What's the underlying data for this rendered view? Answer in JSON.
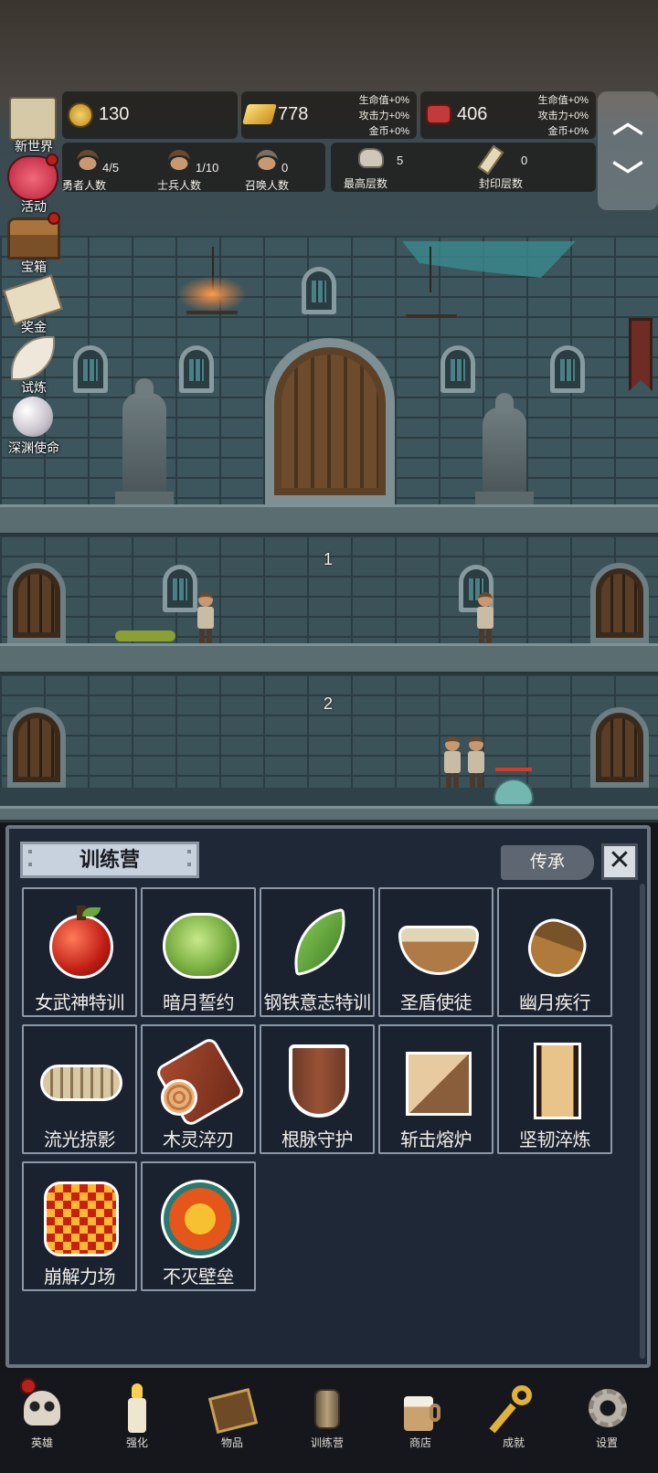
{
  "resources": {
    "gold": "130",
    "gold_bars": "778",
    "gold_bars_bonus": [
      "生命值+0%",
      "攻击力+0%",
      "金币+0%"
    ],
    "meat": "406",
    "meat_bonus": [
      "生命值+0%",
      "攻击力+0%",
      "金币+0%"
    ]
  },
  "stats": {
    "heroes": {
      "value": "4/5",
      "label": "勇者人数"
    },
    "soldiers": {
      "value": "1/10",
      "label": "士兵人数"
    },
    "summons": {
      "value": "0",
      "label": "召唤人数"
    },
    "max_floor": {
      "value": "5",
      "label": "最高层数"
    },
    "sealed_floor": {
      "value": "0",
      "label": "封印层数"
    }
  },
  "side_menu": [
    {
      "label": "新世界",
      "badge": false
    },
    {
      "label": "活动",
      "badge": true
    },
    {
      "label": "宝箱",
      "badge": true
    },
    {
      "label": "奖金",
      "badge": false
    },
    {
      "label": "试炼",
      "badge": false
    },
    {
      "label": "深渊使命",
      "badge": false
    }
  ],
  "floors": [
    "1",
    "2"
  ],
  "panel": {
    "title": "训练营",
    "inherit_label": "传承",
    "close_label": "✕",
    "items": [
      {
        "name": "女武神特训",
        "icon": "apple-icon"
      },
      {
        "name": "暗月誓约",
        "icon": "cabbage-icon"
      },
      {
        "name": "钢铁意志特训",
        "icon": "leaf-icon"
      },
      {
        "name": "圣盾使徒",
        "icon": "porridge-bowl-icon"
      },
      {
        "name": "幽月疾行",
        "icon": "acorn-icon"
      },
      {
        "name": "流光掠影",
        "icon": "fish-bone-icon"
      },
      {
        "name": "木灵淬刃",
        "icon": "log-icon"
      },
      {
        "name": "根脉守护",
        "icon": "wooden-shield-icon"
      },
      {
        "name": "斩击熔炉",
        "icon": "wood-block-icon"
      },
      {
        "name": "坚韧淬炼",
        "icon": "tower-shield-icon"
      },
      {
        "name": "崩解力场",
        "icon": "lava-orb-icon"
      },
      {
        "name": "不灭壁垒",
        "icon": "sun-shield-icon"
      }
    ]
  },
  "nav": [
    {
      "label": "英雄",
      "icon": "skull-icon",
      "badge": true
    },
    {
      "label": "强化",
      "icon": "candle-icon",
      "badge": false
    },
    {
      "label": "物品",
      "icon": "book-icon",
      "badge": false
    },
    {
      "label": "训练营",
      "icon": "lantern-icon",
      "badge": false
    },
    {
      "label": "商店",
      "icon": "beer-mug-icon",
      "badge": false
    },
    {
      "label": "成就",
      "icon": "key-icon",
      "badge": false
    },
    {
      "label": "设置",
      "icon": "gear-icon",
      "badge": false
    }
  ],
  "colors": {
    "panel_bg": "#1e2836",
    "badge": "#b8201c",
    "hp_bar": "#d63a2a"
  }
}
